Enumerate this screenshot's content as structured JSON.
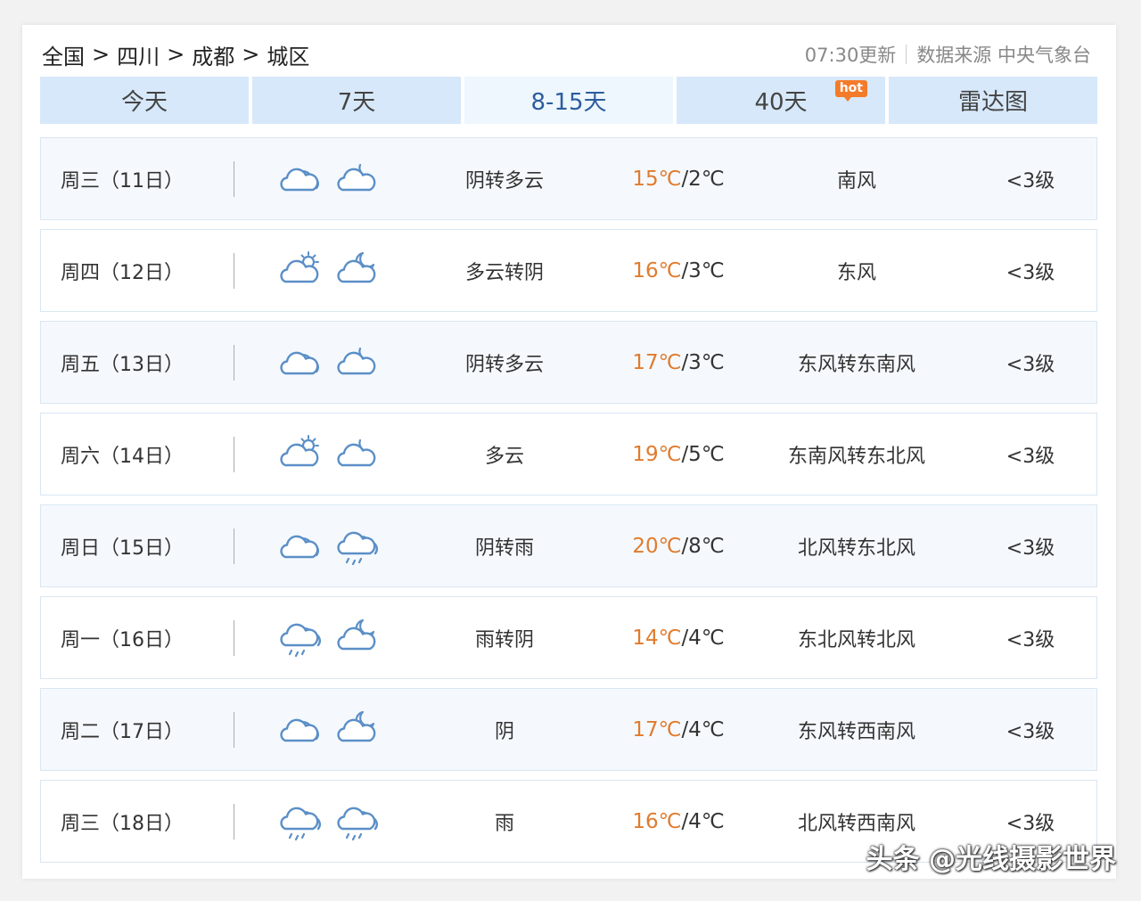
{
  "breadcrumb": [
    "全国",
    "四川",
    "成都",
    "城区"
  ],
  "breadcrumb_sep": ">",
  "meta": {
    "updated": "07:30更新",
    "source": "数据来源 中央气象台"
  },
  "tabs": [
    {
      "label": "今天",
      "active": false
    },
    {
      "label": "7天",
      "active": false
    },
    {
      "label": "8-15天",
      "active": true
    },
    {
      "label": "40天",
      "active": false,
      "badge": "hot"
    },
    {
      "label": "雷达图",
      "active": false
    }
  ],
  "forecast": [
    {
      "day": "周三（11日）",
      "icons": [
        "cloudy-icon",
        "cloudy-night-icon"
      ],
      "desc": "阴转多云",
      "high": "15℃",
      "low": "/2℃",
      "wind": "南风",
      "level": "<3级"
    },
    {
      "day": "周四（12日）",
      "icons": [
        "partly-cloudy-day-icon",
        "cloudy-moon-icon"
      ],
      "desc": "多云转阴",
      "high": "16℃",
      "low": "/3℃",
      "wind": "东风",
      "level": "<3级"
    },
    {
      "day": "周五（13日）",
      "icons": [
        "cloudy-icon",
        "cloudy-night-icon"
      ],
      "desc": "阴转多云",
      "high": "17℃",
      "low": "/3℃",
      "wind": "东风转东南风",
      "level": "<3级"
    },
    {
      "day": "周六（14日）",
      "icons": [
        "partly-cloudy-day-icon",
        "cloudy-night-icon"
      ],
      "desc": "多云",
      "high": "19℃",
      "low": "/5℃",
      "wind": "东南风转东北风",
      "level": "<3级"
    },
    {
      "day": "周日（15日）",
      "icons": [
        "cloudy-icon",
        "rain-icon"
      ],
      "desc": "阴转雨",
      "high": "20℃",
      "low": "/8℃",
      "wind": "北风转东北风",
      "level": "<3级"
    },
    {
      "day": "周一（16日）",
      "icons": [
        "rain-icon",
        "cloudy-moon-icon"
      ],
      "desc": "雨转阴",
      "high": "14℃",
      "low": "/4℃",
      "wind": "东北风转北风",
      "level": "<3级"
    },
    {
      "day": "周二（17日）",
      "icons": [
        "cloudy-icon",
        "cloudy-moon-icon"
      ],
      "desc": "阴",
      "high": "17℃",
      "low": "/4℃",
      "wind": "东风转西南风",
      "level": "<3级"
    },
    {
      "day": "周三（18日）",
      "icons": [
        "rain-icon",
        "rain-icon"
      ],
      "desc": "雨",
      "high": "16℃",
      "low": "/4℃",
      "wind": "北风转西南风",
      "level": "<3级"
    }
  ],
  "watermark": "头条 @光线摄影世界",
  "colors": {
    "tab_bg": "#d7e8fa",
    "tab_active_bg": "#eef6fe",
    "tab_active_text": "#2b5d9c",
    "high_temp": "#e07b2e",
    "icon_stroke": "#5b8fc7",
    "hot_badge": "#f47b2a"
  }
}
